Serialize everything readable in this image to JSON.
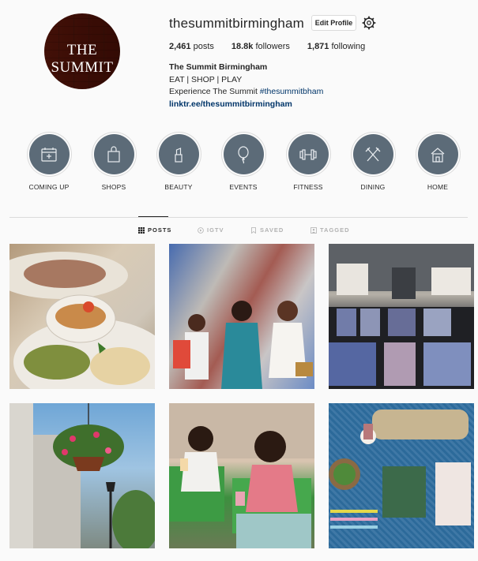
{
  "profile": {
    "username": "thesummitbirmingham",
    "edit_label": "Edit Profile",
    "avatar_text_main": "THE SUMMIT",
    "stats": {
      "posts": "2,461",
      "posts_label": "posts",
      "followers": "18.8k",
      "followers_label": "followers",
      "following": "1,871",
      "following_label": "following"
    },
    "bio": {
      "name": "The Summit Birmingham",
      "line1": "EAT | SHOP | PLAY",
      "line2_prefix": "Experience The Summit ",
      "hashtag": "#thesummitbham",
      "link": "linktr.ee/thesummitbirmingham"
    }
  },
  "highlights": [
    {
      "label": "COMING UP",
      "icon": "calendar-icon"
    },
    {
      "label": "SHOPS",
      "icon": "shopping-bag-icon"
    },
    {
      "label": "BEAUTY",
      "icon": "lipstick-icon"
    },
    {
      "label": "EVENTS",
      "icon": "balloon-icon"
    },
    {
      "label": "FITNESS",
      "icon": "dumbbell-icon"
    },
    {
      "label": "DINING",
      "icon": "fork-knife-icon"
    },
    {
      "label": "HOME",
      "icon": "house-icon"
    }
  ],
  "tabs": [
    {
      "label": "POSTS",
      "active": true
    },
    {
      "label": "IGTV",
      "active": false
    },
    {
      "label": "SAVED",
      "active": false
    },
    {
      "label": "TAGGED",
      "active": false
    }
  ],
  "colors": {
    "highlight_bg": "#5c6b78",
    "link": "#003569"
  }
}
